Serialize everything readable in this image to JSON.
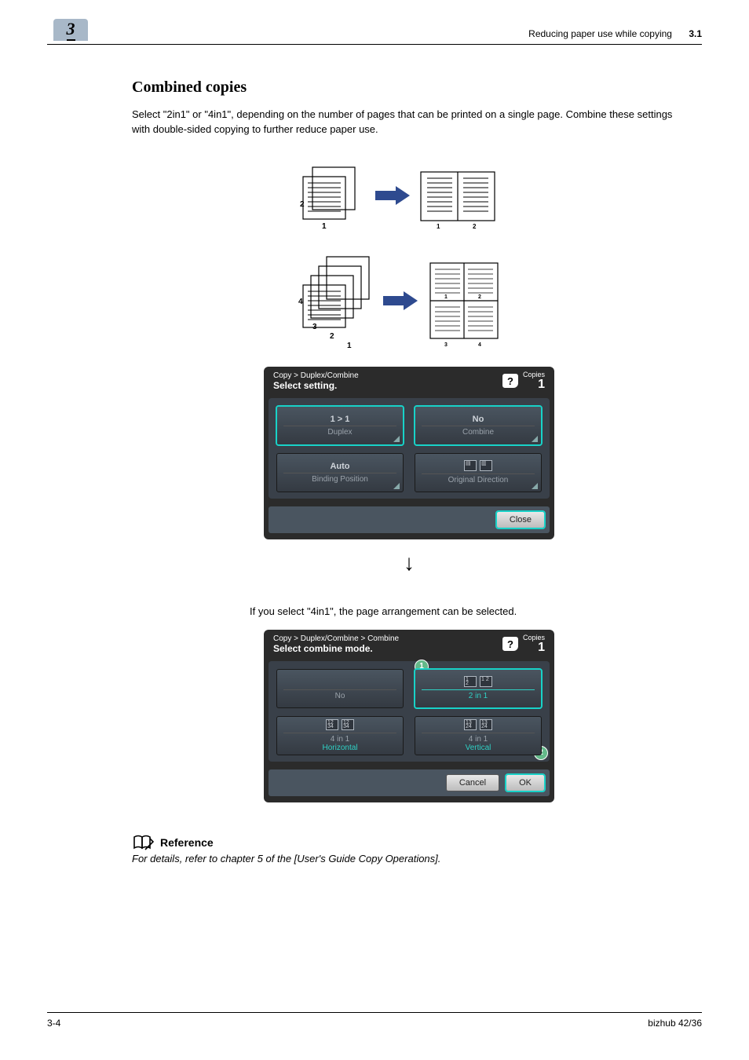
{
  "header": {
    "chapter_tab": "3",
    "running_title": "Reducing paper use while copying",
    "section_number": "3.1"
  },
  "content": {
    "heading": "Combined copies",
    "intro": "Select \"2in1\" or \"4in1\", depending on the number of pages that can be printed on a single page. Combine these settings with double-sided copying to further reduce paper use.",
    "midtext": "If you select \"4in1\", the page arrangement can be selected."
  },
  "diagram": {
    "top_src_labels": [
      "2",
      "1"
    ],
    "top_out_labels": [
      "1",
      "2"
    ],
    "bot_src_labels": [
      "4",
      "3",
      "2",
      "1"
    ],
    "bot_out_labels": [
      "1",
      "2",
      "3",
      "4"
    ]
  },
  "panel1": {
    "breadcrumb": "Copy > Duplex/Combine",
    "subtitle": "Select setting.",
    "copies_label": "Copies",
    "copies_value": "1",
    "options": {
      "duplex": {
        "value": "1 > 1",
        "label": "Duplex"
      },
      "combine": {
        "value": "No",
        "label": "Combine"
      },
      "binding": {
        "value": "Auto",
        "label": "Binding Position"
      },
      "orig": {
        "value": "",
        "label": "Original Direction"
      }
    },
    "close": "Close"
  },
  "panel2": {
    "breadcrumb": "Copy > Duplex/Combine > Combine",
    "subtitle": "Select combine mode.",
    "copies_label": "Copies",
    "copies_value": "1",
    "callout1": "1",
    "callout2": "2",
    "options": {
      "no": {
        "label": "No"
      },
      "two": {
        "label": "2 in 1"
      },
      "fourh": {
        "label": "4 in 1",
        "sub": "Horizontal"
      },
      "fourv": {
        "label": "4 in 1",
        "sub": "Vertical"
      }
    },
    "cancel": "Cancel",
    "ok": "OK"
  },
  "reference": {
    "title": "Reference",
    "text": "For details, refer to chapter 5 of the [User's Guide Copy Operations]."
  },
  "footer": {
    "page": "3-4",
    "product": "bizhub 42/36"
  }
}
